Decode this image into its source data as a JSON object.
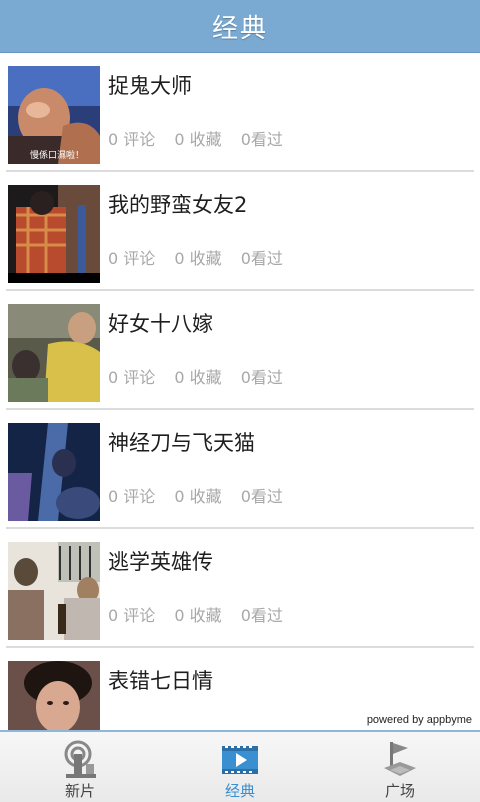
{
  "header": {
    "title": "经典"
  },
  "movies": [
    {
      "name": "捉鬼大师",
      "comments": "0 评论",
      "favorites": "0 收藏",
      "watched": "0看过",
      "caption": "慢係口濕啦！"
    },
    {
      "name": "我的野蛮女友2",
      "comments": "0 评论",
      "favorites": "0 收藏",
      "watched": "0看过",
      "caption": ""
    },
    {
      "name": "好女十八嫁",
      "comments": "0 评论",
      "favorites": "0 收藏",
      "watched": "0看过",
      "caption": ""
    },
    {
      "name": "神经刀与飞天猫",
      "comments": "0 评论",
      "favorites": "0 收藏",
      "watched": "0看过",
      "caption": ""
    },
    {
      "name": "逃学英雄传",
      "comments": "0 评论",
      "favorites": "0 收藏",
      "watched": "0看过",
      "caption": ""
    },
    {
      "name": "表错七日情",
      "comments": "",
      "favorites": "",
      "watched": "",
      "caption": ""
    }
  ],
  "powered_by": "powered by appbyme",
  "tabs": [
    {
      "label": "新片",
      "icon": "antenna-icon",
      "active": false
    },
    {
      "label": "经典",
      "icon": "film-play-icon",
      "active": true
    },
    {
      "label": "广场",
      "icon": "flag-plaza-icon",
      "active": false
    }
  ],
  "colors": {
    "header": "#7aa9d1",
    "active_tab": "#3a8fd0",
    "stats_text": "#a8a8a8"
  }
}
